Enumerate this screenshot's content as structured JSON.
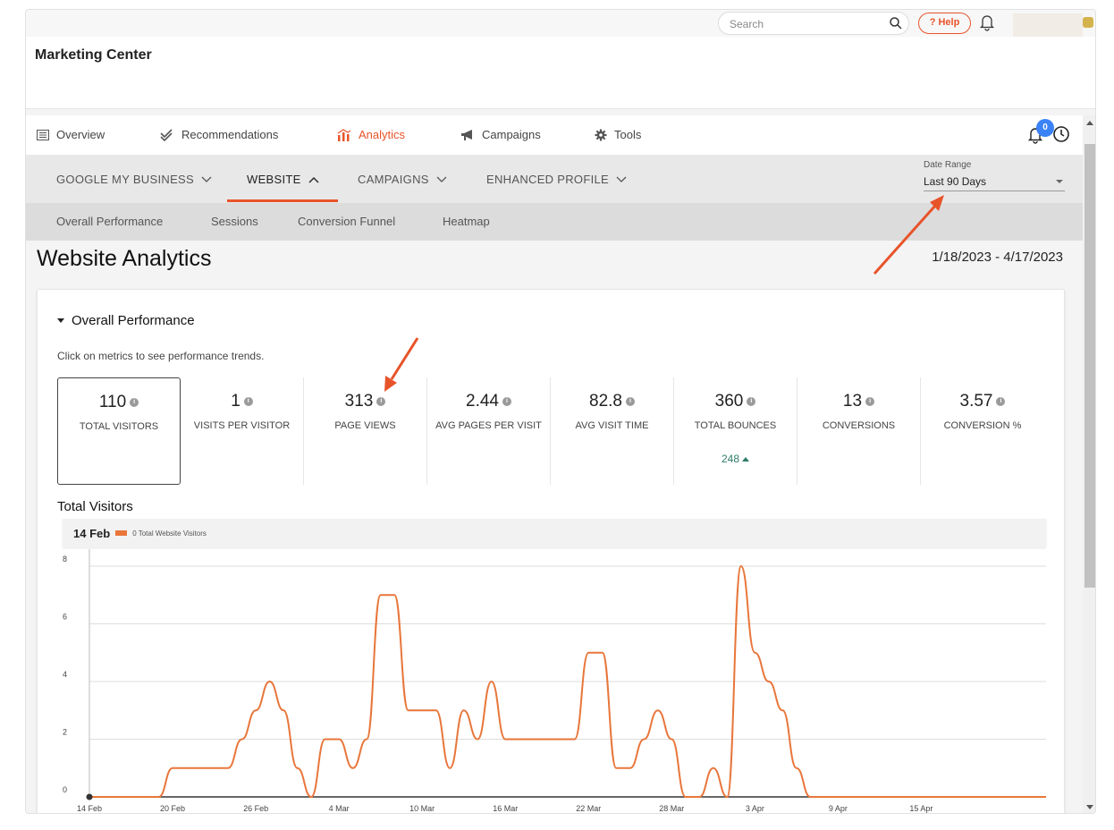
{
  "topbar": {
    "search_placeholder": "Search",
    "help_label": "? Help"
  },
  "header": {
    "title": "Marketing Center"
  },
  "main_nav": {
    "items": [
      {
        "label": "Overview",
        "icon": "list-icon"
      },
      {
        "label": "Recommendations",
        "icon": "double-check-icon"
      },
      {
        "label": "Analytics",
        "icon": "bar-chart-icon"
      },
      {
        "label": "Campaigns",
        "icon": "megaphone-icon"
      },
      {
        "label": "Tools",
        "icon": "gear-icon"
      }
    ],
    "active": "Analytics",
    "notification_count": "0"
  },
  "sub_nav": {
    "items": [
      "GOOGLE MY BUSINESS",
      "WEBSITE",
      "CAMPAIGNS",
      "ENHANCED PROFILE"
    ],
    "active": "WEBSITE",
    "date_range_label": "Date Range",
    "date_range_value": "Last 90 Days"
  },
  "tert_nav": {
    "items": [
      "Overall Performance",
      "Sessions",
      "Conversion Funnel",
      "Heatmap"
    ]
  },
  "page": {
    "title": "Website Analytics",
    "date_span": "1/18/2023 - 4/17/2023",
    "section_title": "Overall Performance",
    "hint": "Click on metrics to see performance trends."
  },
  "metrics": [
    {
      "value": "110",
      "label": "TOTAL VISITORS",
      "selected": true
    },
    {
      "value": "1",
      "label": "VISITS PER VISITOR"
    },
    {
      "value": "313",
      "label": "PAGE VIEWS"
    },
    {
      "value": "2.44",
      "label": "AVG PAGES PER VISIT"
    },
    {
      "value": "82.8",
      "label": "AVG VISIT TIME"
    },
    {
      "value": "360",
      "label": "TOTAL BOUNCES",
      "sub": "248"
    },
    {
      "value": "13",
      "label": "CONVERSIONS"
    },
    {
      "value": "3.57",
      "label": "CONVERSION %"
    }
  ],
  "chart_section": {
    "title": "Total Visitors",
    "tooltip_date": "14 Feb",
    "tooltip_text": "0 Total Website Visitors"
  },
  "colors": {
    "accent": "#e8542a",
    "line": "#e8763b",
    "badge": "#3b82f6",
    "positive": "#2e7d68"
  },
  "chart_data": {
    "type": "line",
    "series": [
      {
        "name": "Total Website Visitors",
        "values": [
          0,
          0,
          0,
          0,
          0,
          0,
          1,
          1,
          1,
          1,
          1,
          2,
          3,
          4,
          3,
          1,
          0,
          2,
          2,
          1,
          2,
          7,
          7,
          3,
          3,
          3,
          1,
          3,
          2,
          4,
          2,
          2,
          2,
          2,
          2,
          2,
          5,
          5,
          1,
          1,
          2,
          3,
          2,
          0,
          0,
          1,
          0,
          8,
          5,
          4,
          3,
          1,
          0,
          0,
          0,
          0,
          0,
          0,
          0,
          0,
          0,
          0,
          0,
          0,
          0,
          0,
          0,
          0,
          0,
          0
        ]
      }
    ],
    "x_start": "14 Feb",
    "x_step_days": 1,
    "xticks": [
      "14 Feb",
      "20 Feb",
      "26 Feb",
      "4 Mar",
      "10 Mar",
      "16 Mar",
      "22 Mar",
      "28 Mar",
      "3 Apr",
      "9 Apr",
      "15 Apr"
    ],
    "yticks": [
      0,
      2,
      4,
      6,
      8
    ],
    "ylim": [
      0,
      8
    ],
    "grid": true
  }
}
